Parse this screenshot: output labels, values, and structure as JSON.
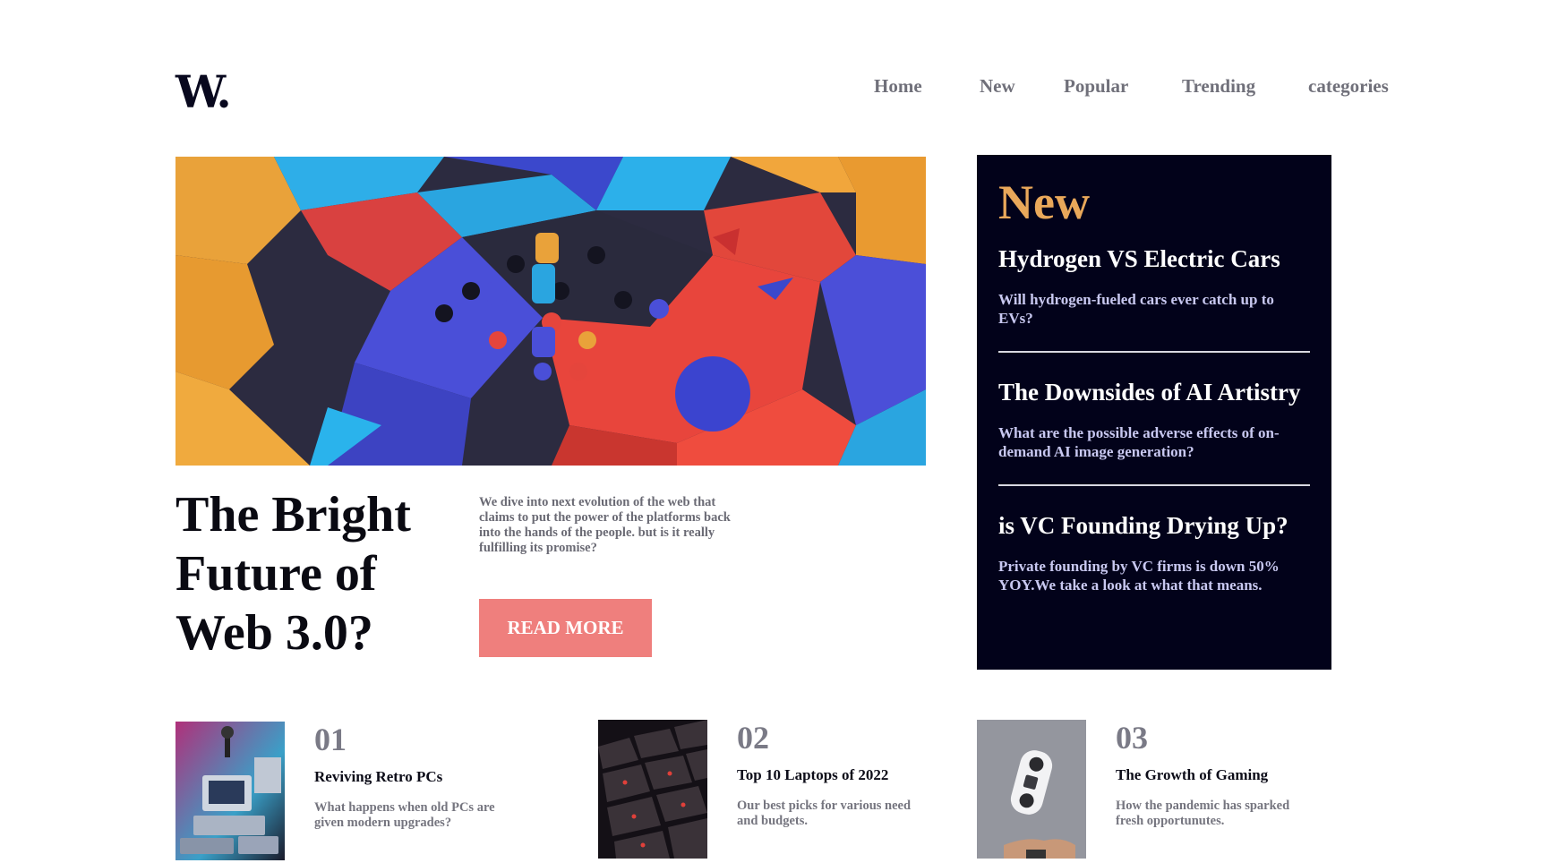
{
  "logo": "W.",
  "nav": {
    "items": [
      "Home",
      "New",
      "Popular",
      "Trending",
      "categories"
    ]
  },
  "hero": {
    "title": "The Bright Future of Web 3.0?",
    "description": "We dive into next evolution of the web that claims to put the power of the platforms back into the hands of the people. but is it really fulfilling its promise?",
    "button_label": "READ MORE",
    "image_icon": "abstract-3d-blocks-image"
  },
  "new_panel": {
    "heading": "New",
    "items": [
      {
        "title": "Hydrogen VS Electric Cars",
        "description": "Will hydrogen-fueled cars ever catch up to EVs?"
      },
      {
        "title": "The Downsides of AI Artistry",
        "description": "What are the possible adverse effects of on-demand AI image generation?"
      },
      {
        "title": "is VC Founding Drying Up?",
        "description": "Private founding by VC firms is down 50% YOY.We take a look at what that means."
      }
    ]
  },
  "articles": [
    {
      "number": "01",
      "title": "Reviving Retro PCs",
      "description": "What happens when old PCs are given modern upgrades?",
      "image_icon": "retro-pc-image"
    },
    {
      "number": "02",
      "title": "Top 10 Laptops of 2022",
      "description": "Our best picks for various need and budgets.",
      "image_icon": "laptop-keyboard-image"
    },
    {
      "number": "03",
      "title": "The Growth of Gaming",
      "description": "How the pandemic has sparked fresh opportunutes.",
      "image_icon": "game-controller-image"
    }
  ],
  "colors": {
    "panel_bg": "#02021a",
    "accent_gold": "#e9a85a",
    "button_bg": "#ef7f7d",
    "muted_text": "#75757f"
  }
}
